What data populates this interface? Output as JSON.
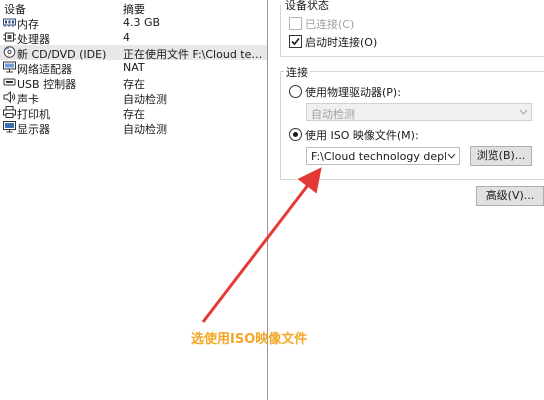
{
  "device_list": {
    "header": {
      "device": "设备",
      "summary": "摘要"
    },
    "rows": [
      {
        "name": "内存",
        "value": "4.3 GB",
        "icon": "memory-icon"
      },
      {
        "name": "处理器",
        "value": "4",
        "icon": "cpu-icon"
      },
      {
        "name": "新 CD/DVD (IDE)",
        "value": "正在使用文件 F:\\Cloud techn...",
        "icon": "cd-dvd-icon",
        "selected": true
      },
      {
        "name": "网络适配器",
        "value": "NAT",
        "icon": "network-icon"
      },
      {
        "name": "USB 控制器",
        "value": "存在",
        "icon": "usb-icon"
      },
      {
        "name": "声卡",
        "value": "自动检测",
        "icon": "speaker-icon"
      },
      {
        "name": "打印机",
        "value": "存在",
        "icon": "printer-icon"
      },
      {
        "name": "显示器",
        "value": "自动检测",
        "icon": "display-icon"
      }
    ]
  },
  "device_status": {
    "title": "设备状态",
    "connected_label": "已连接(C)",
    "connected_checked": false,
    "connected_disabled": true,
    "connect_on_start_label": "启动时连接(O)",
    "connect_on_start_checked": true
  },
  "connection": {
    "title": "连接",
    "physical_label": "使用物理驱动器(P):",
    "physical_selected": false,
    "physical_value": "自动检测",
    "iso_label": "使用 ISO 映像文件(M):",
    "iso_selected": true,
    "iso_path": "F:\\Cloud technology deploymer",
    "browse_label": "浏览(B)..."
  },
  "advanced_label": "高级(V)...",
  "annotation": {
    "text": "选使用ISO映像文件",
    "color": "#f5a623",
    "arrow_color": "#e53935"
  }
}
